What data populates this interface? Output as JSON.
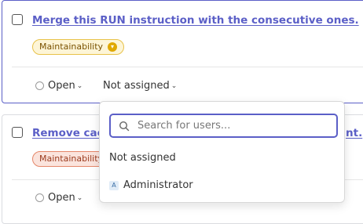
{
  "issues": [
    {
      "title": "Merge this RUN instruction with the consecutive ones.",
      "tag": "Maintainability",
      "status": "Open",
      "assignee": "Not assigned"
    },
    {
      "title_left": "Remove cache",
      "title_right": "nt.",
      "tag": "Maintainability",
      "status": "Open"
    }
  ],
  "dropdown": {
    "search_placeholder": "Search for users...",
    "items": [
      {
        "label": "Not assigned"
      },
      {
        "label": "Administrator",
        "avatar": "A"
      }
    ]
  },
  "colors": {
    "accent": "#5b5fc7",
    "tag_yellow_bg": "#fdf5d7",
    "tag_red_bg": "#fbe4dd"
  }
}
